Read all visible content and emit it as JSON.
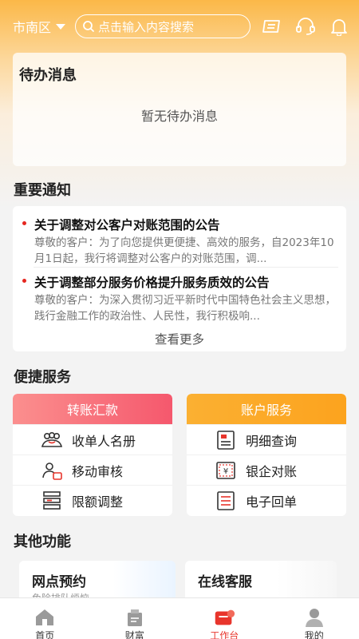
{
  "header": {
    "district": "市南区",
    "search_placeholder": "点击输入内容搜索",
    "icons": [
      "scan-icon",
      "customer-service-icon",
      "bell-icon"
    ]
  },
  "todo": {
    "title": "待办消息",
    "empty_text": "暂无待办消息"
  },
  "notices": {
    "title": "重要通知",
    "items": [
      {
        "title": "关于调整对公客户对账范围的公告",
        "desc": "尊敬的客户：为了向您提供更便捷、高效的服务，自2023年10月1日起，我行将调整对公客户的对账范围，调..."
      },
      {
        "title": "关于调整部分服务价格提升服务质效的公告",
        "desc": "尊敬的客户：为深入贯彻习近平新时代中国特色社会主义思想，践行金融工作的政治性、人民性，我行积极响..."
      }
    ],
    "more": "查看更多"
  },
  "quick": {
    "title": "便捷服务",
    "transfer": {
      "header": "转账汇款",
      "items": [
        {
          "label": "收单人名册",
          "icon": "people-icon"
        },
        {
          "label": "移动审核",
          "icon": "user-review-icon"
        },
        {
          "label": "限额调整",
          "icon": "limit-adjust-icon"
        }
      ]
    },
    "account": {
      "header": "账户服务",
      "items": [
        {
          "label": "明细查询",
          "icon": "detail-query-icon"
        },
        {
          "label": "银企对账",
          "icon": "reconcile-icon"
        },
        {
          "label": "电子回单",
          "icon": "e-receipt-icon"
        }
      ]
    }
  },
  "other": {
    "title": "其他功能",
    "items": [
      {
        "title": "网点预约",
        "sub": "免除排队烦恼"
      },
      {
        "title": "在线客服",
        "sub": ""
      }
    ]
  },
  "tabs": [
    {
      "label": "首页",
      "icon": "home-icon"
    },
    {
      "label": "财富",
      "icon": "wealth-icon"
    },
    {
      "label": "工作台",
      "icon": "workbench-icon",
      "active": true
    },
    {
      "label": "我的",
      "icon": "profile-icon"
    }
  ],
  "colors": {
    "accent_red": "#e8352c",
    "transfer_header": "#f5586d",
    "account_header": "#fca31e",
    "header_orange": "#fbb848"
  }
}
